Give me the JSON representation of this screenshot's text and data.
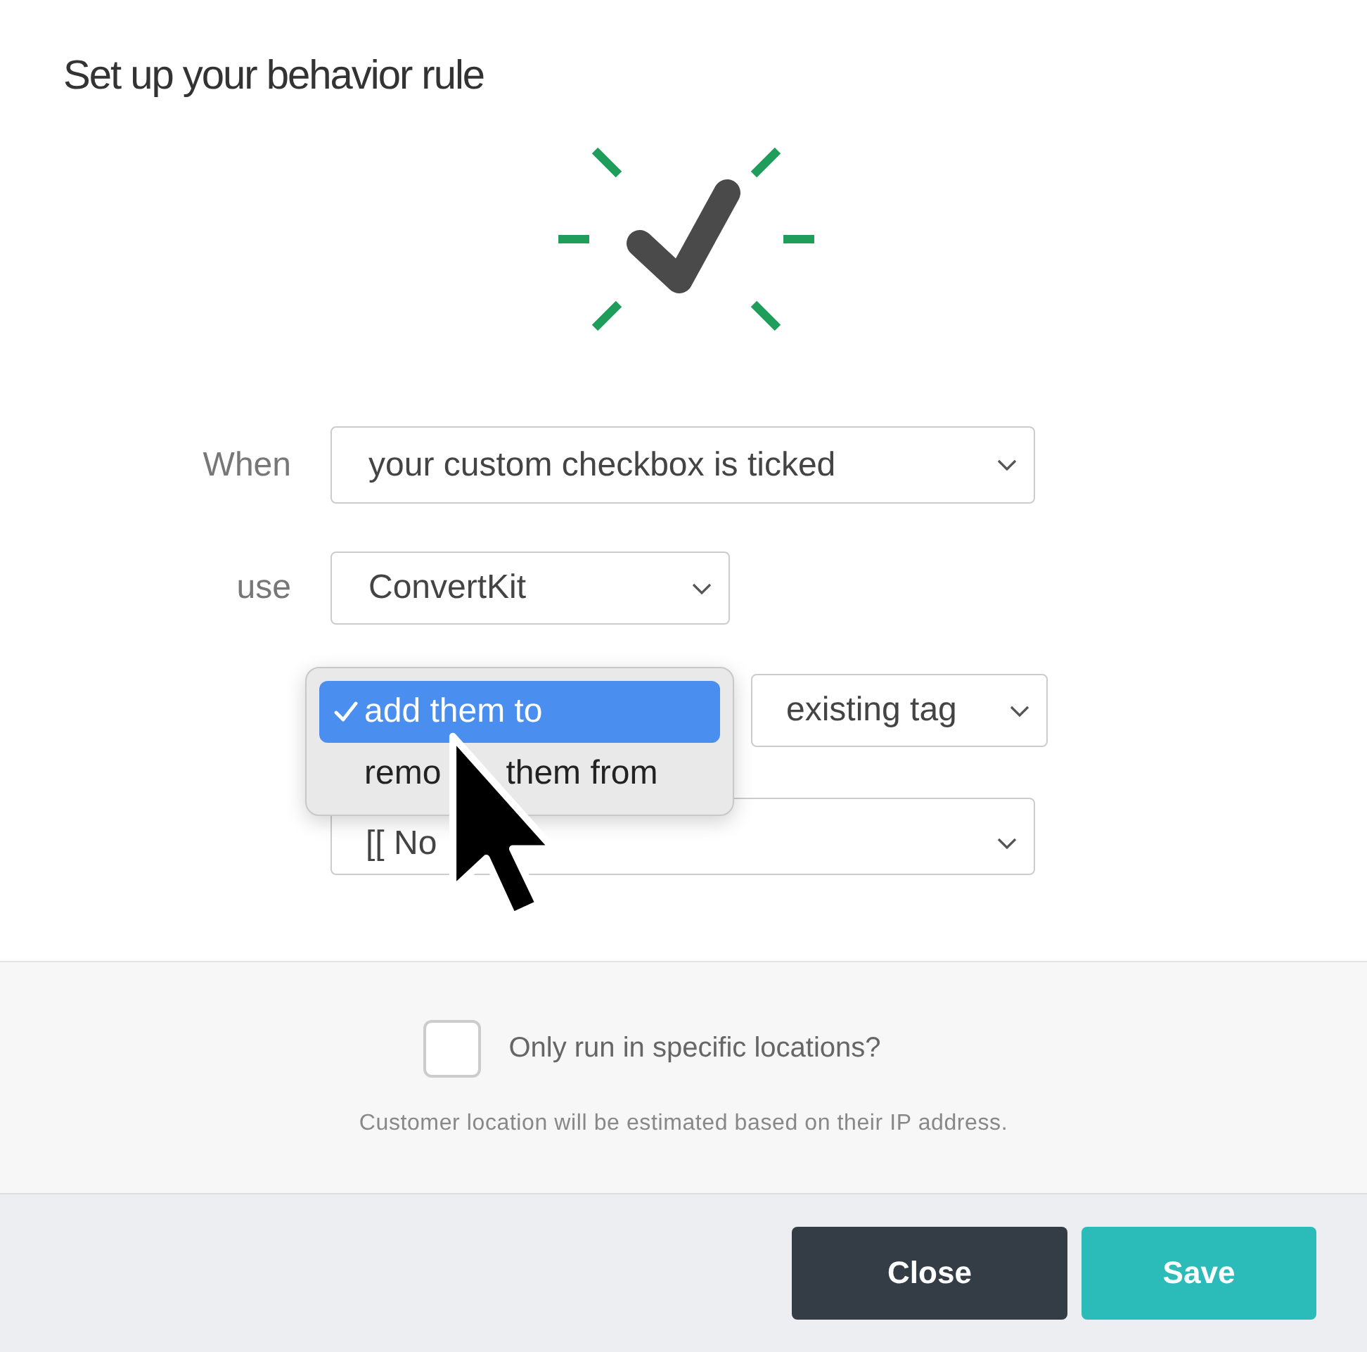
{
  "dialog": {
    "title": "Set up your behavior rule"
  },
  "rows": [
    {
      "label": "When",
      "value": "your custom checkbox is ticked"
    },
    {
      "label": "use",
      "value": "ConvertKit"
    }
  ],
  "action_menu": {
    "options": [
      {
        "text_parts": [
          "add them to"
        ],
        "selected": true
      },
      {
        "text_parts": [
          "remo",
          "them from"
        ],
        "selected": false
      }
    ]
  },
  "tag_type": {
    "value": "existing tag"
  },
  "tag": {
    "value": "[[ No"
  },
  "location": {
    "checked": false,
    "label": "Only run in specific locations?",
    "hint": "Customer location will be estimated based on their IP address."
  },
  "buttons": [
    {
      "label": "Close",
      "kind": "secondary"
    },
    {
      "label": "Save",
      "kind": "primary"
    }
  ]
}
